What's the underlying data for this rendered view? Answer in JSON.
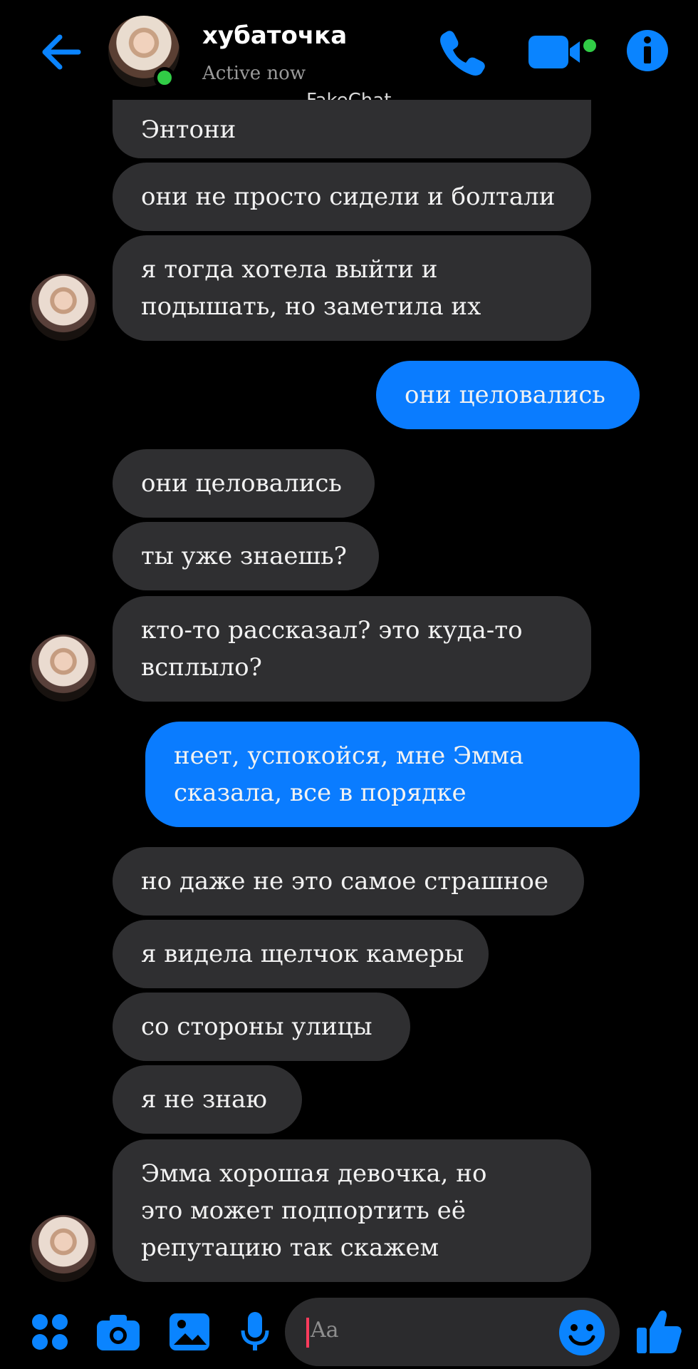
{
  "header": {
    "contact_name": "хубаточка",
    "status": "Active now",
    "watermark": "FakeChat"
  },
  "icons": {
    "back": "arrow-left-icon",
    "call": "phone-icon",
    "video": "video-camera-icon",
    "info": "info-icon",
    "apps": "apps-grid-icon",
    "camera": "camera-icon",
    "gallery": "image-icon",
    "mic": "microphone-icon",
    "emoji": "emoji-icon",
    "like": "thumbs-up-icon"
  },
  "colors": {
    "accent": "#0a7cff",
    "incoming_bubble": "#2f2f31",
    "online": "#31cc46",
    "background": "#000000"
  },
  "messages": [
    {
      "from": "them",
      "lines": [
        "Энтони"
      ]
    },
    {
      "from": "them",
      "lines": [
        "они не просто сидели и болтали"
      ]
    },
    {
      "from": "them",
      "lines": [
        "я тогда хотела выйти и",
        "подышать, но заметила их"
      ]
    },
    {
      "from": "me",
      "lines": [
        "они целовались"
      ]
    },
    {
      "from": "them",
      "lines": [
        "они целовались"
      ]
    },
    {
      "from": "them",
      "lines": [
        "ты уже знаешь?"
      ]
    },
    {
      "from": "them",
      "lines": [
        "кто-то рассказал? это куда-то",
        "всплыло?"
      ]
    },
    {
      "from": "me",
      "lines": [
        "неет, успокойся, мне Эмма",
        "сказала, все в порядке"
      ]
    },
    {
      "from": "them",
      "lines": [
        "но даже не это самое страшное"
      ]
    },
    {
      "from": "them",
      "lines": [
        "я видела щелчок камеры"
      ]
    },
    {
      "from": "them",
      "lines": [
        "со стороны улицы"
      ]
    },
    {
      "from": "them",
      "lines": [
        "я не знаю"
      ]
    },
    {
      "from": "them",
      "lines": [
        "Эмма хорошая девочка, но",
        "это может подпортить её",
        "репутацию так скажем"
      ]
    }
  ],
  "composer": {
    "placeholder": "Aa"
  }
}
